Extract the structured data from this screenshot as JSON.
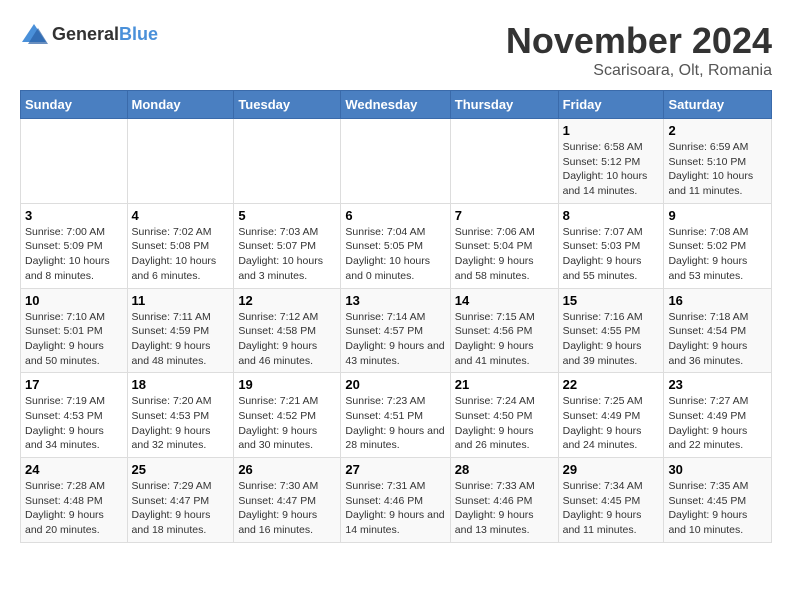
{
  "logo": {
    "text_general": "General",
    "text_blue": "Blue"
  },
  "title": "November 2024",
  "location": "Scarisoara, Olt, Romania",
  "days_of_week": [
    "Sunday",
    "Monday",
    "Tuesday",
    "Wednesday",
    "Thursday",
    "Friday",
    "Saturday"
  ],
  "weeks": [
    [
      {
        "day": "",
        "info": ""
      },
      {
        "day": "",
        "info": ""
      },
      {
        "day": "",
        "info": ""
      },
      {
        "day": "",
        "info": ""
      },
      {
        "day": "",
        "info": ""
      },
      {
        "day": "1",
        "info": "Sunrise: 6:58 AM\nSunset: 5:12 PM\nDaylight: 10 hours and 14 minutes."
      },
      {
        "day": "2",
        "info": "Sunrise: 6:59 AM\nSunset: 5:10 PM\nDaylight: 10 hours and 11 minutes."
      }
    ],
    [
      {
        "day": "3",
        "info": "Sunrise: 7:00 AM\nSunset: 5:09 PM\nDaylight: 10 hours and 8 minutes."
      },
      {
        "day": "4",
        "info": "Sunrise: 7:02 AM\nSunset: 5:08 PM\nDaylight: 10 hours and 6 minutes."
      },
      {
        "day": "5",
        "info": "Sunrise: 7:03 AM\nSunset: 5:07 PM\nDaylight: 10 hours and 3 minutes."
      },
      {
        "day": "6",
        "info": "Sunrise: 7:04 AM\nSunset: 5:05 PM\nDaylight: 10 hours and 0 minutes."
      },
      {
        "day": "7",
        "info": "Sunrise: 7:06 AM\nSunset: 5:04 PM\nDaylight: 9 hours and 58 minutes."
      },
      {
        "day": "8",
        "info": "Sunrise: 7:07 AM\nSunset: 5:03 PM\nDaylight: 9 hours and 55 minutes."
      },
      {
        "day": "9",
        "info": "Sunrise: 7:08 AM\nSunset: 5:02 PM\nDaylight: 9 hours and 53 minutes."
      }
    ],
    [
      {
        "day": "10",
        "info": "Sunrise: 7:10 AM\nSunset: 5:01 PM\nDaylight: 9 hours and 50 minutes."
      },
      {
        "day": "11",
        "info": "Sunrise: 7:11 AM\nSunset: 4:59 PM\nDaylight: 9 hours and 48 minutes."
      },
      {
        "day": "12",
        "info": "Sunrise: 7:12 AM\nSunset: 4:58 PM\nDaylight: 9 hours and 46 minutes."
      },
      {
        "day": "13",
        "info": "Sunrise: 7:14 AM\nSunset: 4:57 PM\nDaylight: 9 hours and 43 minutes."
      },
      {
        "day": "14",
        "info": "Sunrise: 7:15 AM\nSunset: 4:56 PM\nDaylight: 9 hours and 41 minutes."
      },
      {
        "day": "15",
        "info": "Sunrise: 7:16 AM\nSunset: 4:55 PM\nDaylight: 9 hours and 39 minutes."
      },
      {
        "day": "16",
        "info": "Sunrise: 7:18 AM\nSunset: 4:54 PM\nDaylight: 9 hours and 36 minutes."
      }
    ],
    [
      {
        "day": "17",
        "info": "Sunrise: 7:19 AM\nSunset: 4:53 PM\nDaylight: 9 hours and 34 minutes."
      },
      {
        "day": "18",
        "info": "Sunrise: 7:20 AM\nSunset: 4:53 PM\nDaylight: 9 hours and 32 minutes."
      },
      {
        "day": "19",
        "info": "Sunrise: 7:21 AM\nSunset: 4:52 PM\nDaylight: 9 hours and 30 minutes."
      },
      {
        "day": "20",
        "info": "Sunrise: 7:23 AM\nSunset: 4:51 PM\nDaylight: 9 hours and 28 minutes."
      },
      {
        "day": "21",
        "info": "Sunrise: 7:24 AM\nSunset: 4:50 PM\nDaylight: 9 hours and 26 minutes."
      },
      {
        "day": "22",
        "info": "Sunrise: 7:25 AM\nSunset: 4:49 PM\nDaylight: 9 hours and 24 minutes."
      },
      {
        "day": "23",
        "info": "Sunrise: 7:27 AM\nSunset: 4:49 PM\nDaylight: 9 hours and 22 minutes."
      }
    ],
    [
      {
        "day": "24",
        "info": "Sunrise: 7:28 AM\nSunset: 4:48 PM\nDaylight: 9 hours and 20 minutes."
      },
      {
        "day": "25",
        "info": "Sunrise: 7:29 AM\nSunset: 4:47 PM\nDaylight: 9 hours and 18 minutes."
      },
      {
        "day": "26",
        "info": "Sunrise: 7:30 AM\nSunset: 4:47 PM\nDaylight: 9 hours and 16 minutes."
      },
      {
        "day": "27",
        "info": "Sunrise: 7:31 AM\nSunset: 4:46 PM\nDaylight: 9 hours and 14 minutes."
      },
      {
        "day": "28",
        "info": "Sunrise: 7:33 AM\nSunset: 4:46 PM\nDaylight: 9 hours and 13 minutes."
      },
      {
        "day": "29",
        "info": "Sunrise: 7:34 AM\nSunset: 4:45 PM\nDaylight: 9 hours and 11 minutes."
      },
      {
        "day": "30",
        "info": "Sunrise: 7:35 AM\nSunset: 4:45 PM\nDaylight: 9 hours and 10 minutes."
      }
    ]
  ]
}
